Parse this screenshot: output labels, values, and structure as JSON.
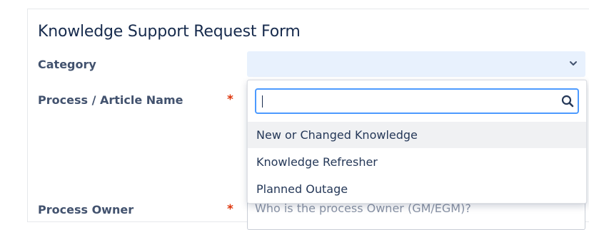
{
  "form": {
    "title": "Knowledge Support Request Form",
    "fields": {
      "category": {
        "label": "Category",
        "value": ""
      },
      "process_article_name": {
        "label": "Process / Article Name",
        "required_marker": "*"
      },
      "process_owner": {
        "label": "Process Owner",
        "required_marker": "*",
        "placeholder": "Who is the process Owner (GM/EGM)?"
      }
    }
  },
  "dropdown": {
    "search_value": "",
    "search_icon": "search-icon",
    "highlighted_index": 0,
    "options": [
      {
        "label": "New or Changed Knowledge"
      },
      {
        "label": "Knowledge Refresher"
      },
      {
        "label": "Planned Outage"
      }
    ]
  },
  "colors": {
    "title": "#172b4d",
    "label": "#42526e",
    "required": "#de350b",
    "select_bg": "#e8f1fd",
    "focus_border": "#4c9aff",
    "option_highlight": "#f0f1f3"
  }
}
